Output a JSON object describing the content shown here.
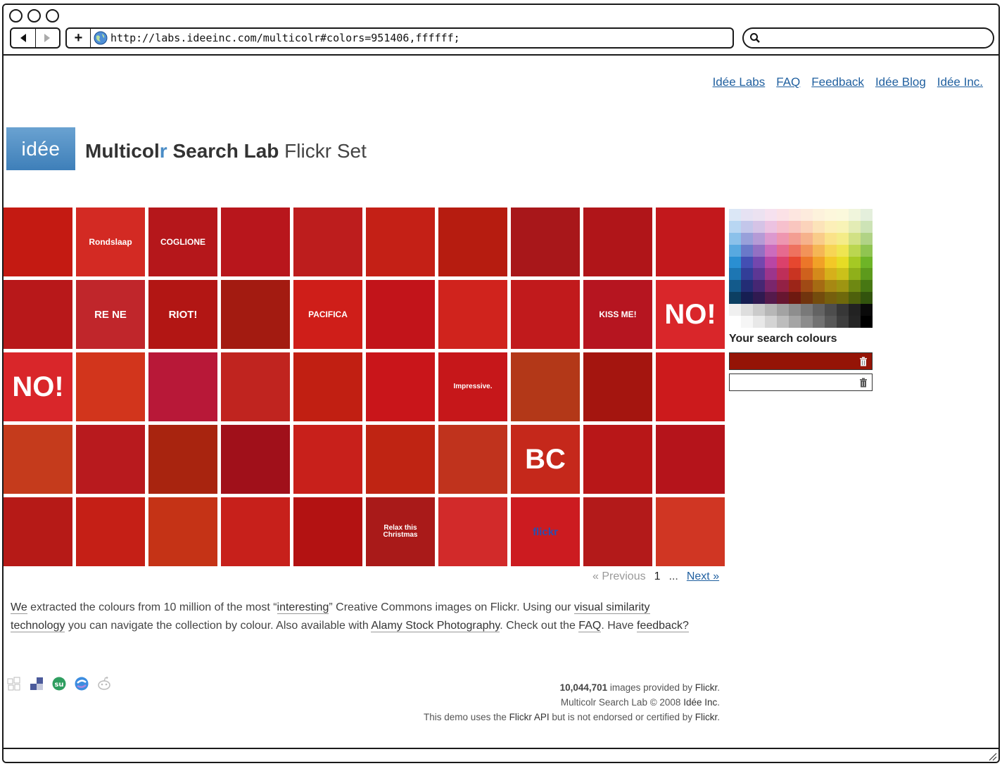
{
  "browser": {
    "url": "http://labs.ideeinc.com/multicolr#colors=951406,ffffff;",
    "search_value": ""
  },
  "nav_links": [
    "Idée Labs",
    "FAQ",
    "Feedback",
    "Idée Blog",
    "Idée Inc."
  ],
  "logo": {
    "text": "idée",
    "bg": "#4f8fc6"
  },
  "title": {
    "part1": "Multicol",
    "part2": "r",
    "part3": " Search Lab",
    "part4": " Flickr Set"
  },
  "thumbs": [
    {
      "caption": "",
      "bg": "#c41a12"
    },
    {
      "caption": "Rondslaap",
      "bg": "#d32a23"
    },
    {
      "caption": "COGLIONE",
      "bg": "#b5171b"
    },
    {
      "caption": "",
      "bg": "#b8161c"
    },
    {
      "caption": "",
      "bg": "#bd1d1d"
    },
    {
      "caption": "",
      "bg": "#c42016"
    },
    {
      "caption": "",
      "bg": "#b61c10"
    },
    {
      "caption": "",
      "bg": "#a8171a"
    },
    {
      "caption": "",
      "bg": "#b01519"
    },
    {
      "caption": "",
      "bg": "#c2181c"
    },
    {
      "caption": "",
      "bg": "#b8181a"
    },
    {
      "caption": "RE NE",
      "bg": "#c0262b"
    },
    {
      "caption": "RIOT!",
      "bg": "#b21614"
    },
    {
      "caption": "",
      "bg": "#a31b11"
    },
    {
      "caption": "PACIFICA",
      "bg": "#cf1e19"
    },
    {
      "caption": "",
      "bg": "#c2141a"
    },
    {
      "caption": "",
      "bg": "#d0231d"
    },
    {
      "caption": "",
      "bg": "#c11a1c"
    },
    {
      "caption": "KISS ME!",
      "bg": "#b61520"
    },
    {
      "caption": "NO!",
      "bg": "#d9262a"
    },
    {
      "caption": "NO!",
      "bg": "#d9262a"
    },
    {
      "caption": "",
      "bg": "#d2351c"
    },
    {
      "caption": "",
      "bg": "#b81838"
    },
    {
      "caption": "",
      "bg": "#c0241f"
    },
    {
      "caption": "",
      "bg": "#c11f12"
    },
    {
      "caption": "",
      "bg": "#c9151a"
    },
    {
      "caption": "Impressive.",
      "bg": "#c6171a"
    },
    {
      "caption": "",
      "bg": "#b33818"
    },
    {
      "caption": "",
      "bg": "#a4150f"
    },
    {
      "caption": "",
      "bg": "#cc1a1c"
    },
    {
      "caption": "",
      "bg": "#c53b1c"
    },
    {
      "caption": "",
      "bg": "#b81a1e"
    },
    {
      "caption": "",
      "bg": "#a8240f"
    },
    {
      "caption": "",
      "bg": "#a0101a"
    },
    {
      "caption": "",
      "bg": "#c8201b"
    },
    {
      "caption": "",
      "bg": "#bf2413"
    },
    {
      "caption": "",
      "bg": "#c0331d"
    },
    {
      "caption": "BC",
      "bg": "#c5281b"
    },
    {
      "caption": "",
      "bg": "#b81718"
    },
    {
      "caption": "",
      "bg": "#b5141b"
    },
    {
      "caption": "",
      "bg": "#b61a17"
    },
    {
      "caption": "",
      "bg": "#c51f16"
    },
    {
      "caption": "",
      "bg": "#c53316"
    },
    {
      "caption": "",
      "bg": "#c7201b"
    },
    {
      "caption": "",
      "bg": "#b31212"
    },
    {
      "caption": "Relax this Christmas",
      "bg": "#a91a19"
    },
    {
      "caption": "",
      "bg": "#d22a2a"
    },
    {
      "caption": "flickr",
      "bg": "#cc1b20"
    },
    {
      "caption": "",
      "bg": "#b31a1a"
    },
    {
      "caption": "",
      "bg": "#d03623"
    }
  ],
  "palette_colors": [
    [
      "#dbe7f6",
      "#e6e2f3",
      "#ece2f1",
      "#f6e1ef",
      "#fbe1e6",
      "#fde6e0",
      "#fdebdd",
      "#fdf2dc",
      "#fdf7dc",
      "#fbf9dc",
      "#f0f5dc",
      "#e4efdc"
    ],
    [
      "#b8d6f2",
      "#c3c6ea",
      "#d5c3e6",
      "#ecc2e1",
      "#f6c0cd",
      "#f9c6bf",
      "#fbd3bb",
      "#fce3b9",
      "#fcefb8",
      "#f8f3b6",
      "#e3ecb5",
      "#cde3b6"
    ],
    [
      "#8bc1ea",
      "#98a0da",
      "#b59bd6",
      "#dc99cf",
      "#ee96b0",
      "#f39e92",
      "#f6b28c",
      "#f9cc8a",
      "#fae289",
      "#f4ec88",
      "#d1e185",
      "#b1d386"
    ],
    [
      "#58a9e0",
      "#6a79c9",
      "#9370c3",
      "#cc6cbd",
      "#e66a8f",
      "#ee725f",
      "#f29359",
      "#f5b655",
      "#f7d555",
      "#efe551",
      "#bbd650",
      "#90c451"
    ],
    [
      "#2a8fd2",
      "#434fb3",
      "#7447ae",
      "#b946a5",
      "#db416b",
      "#e6472f",
      "#ec7629",
      "#f1a127",
      "#f3c827",
      "#e6dc25",
      "#a5c924",
      "#6eb427"
    ],
    [
      "#1d76b3",
      "#323e98",
      "#5d3794",
      "#9c358c",
      "#be2f59",
      "#c93422",
      "#cf611d",
      "#d48a1b",
      "#d6b01b",
      "#cbc11a",
      "#8fb01a",
      "#5d9a1c"
    ],
    [
      "#135a8b",
      "#232d75",
      "#462773",
      "#7a266c",
      "#932145",
      "#9c2518",
      "#a04a15",
      "#a56b13",
      "#a78813",
      "#9e9512",
      "#6e8812",
      "#477713"
    ],
    [
      "#0c3f62",
      "#161e52",
      "#301a51",
      "#551a4c",
      "#671630",
      "#6e1910",
      "#71340e",
      "#744c0d",
      "#765f0d",
      "#6f690c",
      "#4e600c",
      "#32540d"
    ],
    [
      "#f0f0f0",
      "#dedede",
      "#cbcbcb",
      "#b7b7b7",
      "#a3a3a3",
      "#8e8e8e",
      "#797979",
      "#636363",
      "#4d4d4d",
      "#373737",
      "#222222",
      "#0a0a0a"
    ],
    [
      "#ffffff",
      "#f6f6f6",
      "#e8e8e8",
      "#d4d4d4",
      "#bdbdbd",
      "#a5a5a5",
      "#8c8c8c",
      "#727272",
      "#585858",
      "#3e3e3e",
      "#252525",
      "#000000"
    ]
  ],
  "search_colours": {
    "label": "Your search colours",
    "colors": [
      "#951406",
      "#ffffff"
    ]
  },
  "pagination": {
    "prev": "« Previous",
    "current": "1",
    "ellipsis": "...",
    "next": "Next »"
  },
  "description": {
    "t1": "We",
    "t2": " extracted the colours from 10 million of the most ",
    "t3": "“",
    "l1": "interesting",
    "t4": "” Creative Commons images on Flickr. Using our ",
    "l2": "visual similarity technology",
    "t5": " you can navigate the collection by colour. Also available with ",
    "l3": "Alamy Stock Photography",
    "t6": ". Check out the ",
    "l4": "FAQ",
    "t7": ". Have ",
    "l5": "feedback?"
  },
  "social_icons": [
    "delicious-icon",
    "facebook-icon",
    "stumbleupon-icon",
    "technorati-icon",
    "reddit-icon"
  ],
  "footer": {
    "count": "10,044,701",
    "line1_rest": " images provided by ",
    "flickr": "Flickr",
    "line1_end": ".",
    "line2a": "Multicolr Search Lab © 2008 ",
    "line2b": "Idée Inc",
    "line2c": ".",
    "line3a": "This demo uses the ",
    "line3b": "Flickr API",
    "line3c": " but is not endorsed or certified by ",
    "line3d": "Flickr",
    "line3e": "."
  }
}
